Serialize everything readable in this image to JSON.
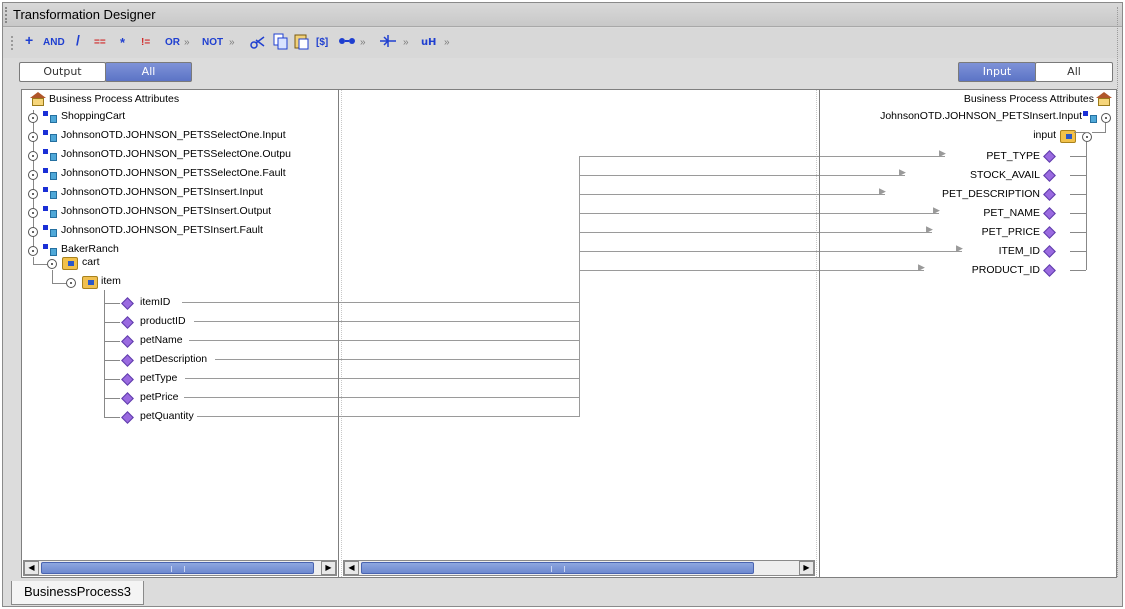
{
  "window": {
    "title": "Transformation Designer"
  },
  "toolbar": {
    "items": [
      {
        "label": "+",
        "icon": "add-icon"
      },
      {
        "label": "AND"
      },
      {
        "label": "/",
        "icon": "divide-icon"
      },
      {
        "label": "=="
      },
      {
        "label": "*",
        "icon": "multiply-icon"
      },
      {
        "label": "!="
      },
      {
        "label": "OR"
      },
      {
        "label": "»"
      },
      {
        "label": "NOT"
      },
      {
        "label": "»"
      },
      {
        "label": "",
        "icon": "scissors-icon"
      },
      {
        "label": "",
        "icon": "copy-icon"
      },
      {
        "label": "",
        "icon": "paste-icon"
      },
      {
        "label": "[$]"
      },
      {
        "label": "",
        "icon": "connect-icon"
      },
      {
        "label": "»"
      },
      {
        "label": "",
        "icon": "split-icon"
      },
      {
        "label": "»"
      },
      {
        "label": "",
        "icon": "string-icon"
      },
      {
        "label": "»"
      }
    ]
  },
  "left_toggle": {
    "output_label": "Output",
    "all_label": "All",
    "selected": "All"
  },
  "right_toggle": {
    "input_label": "Input",
    "all_label": "All",
    "selected": "Input"
  },
  "left_tree": {
    "root_label": "Business Process Attributes",
    "nodes": [
      {
        "label": "ShoppingCart"
      },
      {
        "label": "JohnsonOTD.JOHNSON_PETSSelectOne.Input"
      },
      {
        "label": "JohnsonOTD.JOHNSON_PETSSelectOne.Outpu"
      },
      {
        "label": "JohnsonOTD.JOHNSON_PETSSelectOne.Fault"
      },
      {
        "label": "JohnsonOTD.JOHNSON_PETSInsert.Input"
      },
      {
        "label": "JohnsonOTD.JOHNSON_PETSInsert.Output"
      },
      {
        "label": "JohnsonOTD.JOHNSON_PETSInsert.Fault"
      },
      {
        "label": "BakerRanch"
      }
    ],
    "cart_label": "cart",
    "item_label": "item",
    "fields": [
      "itemID",
      "productID",
      "petName",
      "petDescription",
      "petType",
      "petPrice",
      "petQuantity"
    ]
  },
  "right_tree": {
    "root_label": "Business Process Attributes",
    "node_label": "JohnsonOTD.JOHNSON_PETSInsert.Input",
    "input_label": "input",
    "fields": [
      "PET_TYPE",
      "STOCK_AVAIL",
      "PET_DESCRIPTION",
      "PET_NAME",
      "PET_PRICE",
      "ITEM_ID",
      "PRODUCT_ID"
    ]
  },
  "bottom_tab": {
    "label": "BusinessProcess3"
  },
  "colors": {
    "accent": "#6a82cc",
    "mapping_line": "#9a9a9a",
    "field_diamond": "#9a6ae0"
  }
}
